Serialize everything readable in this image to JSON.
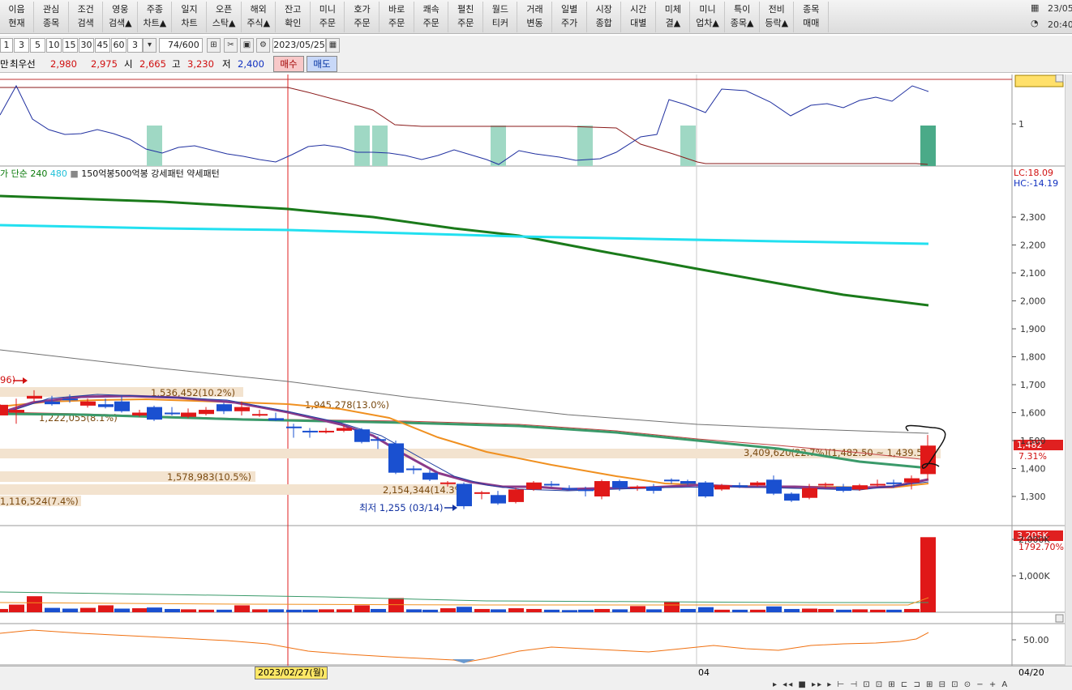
{
  "toolbar": {
    "buttons": [
      {
        "l1": "이음",
        "l2": "현재"
      },
      {
        "l1": "관심",
        "l2": "종목"
      },
      {
        "l1": "조건",
        "l2": "검색"
      },
      {
        "l1": "영웅",
        "l2": "검색▲"
      },
      {
        "l1": "주종",
        "l2": "차트▲"
      },
      {
        "l1": "일지",
        "l2": "차트"
      },
      {
        "l1": "오픈",
        "l2": "스탁▲"
      },
      {
        "l1": "해외",
        "l2": "주식▲"
      },
      {
        "l1": "잔고",
        "l2": "확인"
      },
      {
        "l1": "미니",
        "l2": "주문"
      },
      {
        "l1": "호가",
        "l2": "주문"
      },
      {
        "l1": "바로",
        "l2": "주문"
      },
      {
        "l1": "쾌속",
        "l2": "주문"
      },
      {
        "l1": "펼친",
        "l2": "주문"
      },
      {
        "l1": "월드",
        "l2": "티커"
      },
      {
        "l1": "거래",
        "l2": "변동"
      },
      {
        "l1": "일별",
        "l2": "주가"
      },
      {
        "l1": "시장",
        "l2": "종합"
      },
      {
        "l1": "시간",
        "l2": "대별"
      },
      {
        "l1": "미체",
        "l2": "결▲"
      },
      {
        "l1": "미니",
        "l2": "업차▲"
      },
      {
        "l1": "특이",
        "l2": "종목▲"
      },
      {
        "l1": "전비",
        "l2": "등락▲"
      },
      {
        "l1": "종목",
        "l2": "매매"
      }
    ],
    "date": "23/05",
    "time": "20:40"
  },
  "period": {
    "buttons": [
      "1",
      "3",
      "5",
      "10",
      "15",
      "30",
      "45",
      "60",
      "3"
    ],
    "count": "74",
    "total": "/600",
    "date": "2023/05/25"
  },
  "quote": {
    "prefix": "만",
    "label": "최우선",
    "ask": "2,980",
    "bid": "2,975",
    "open_label": "시",
    "open": "2,665",
    "high_label": "고",
    "high": "3,230",
    "low_label": "저",
    "low": "2,400",
    "buy": "매수",
    "sell": "매도"
  },
  "indicator_top": {
    "tick_label": "1"
  },
  "main_chart": {
    "legend": {
      "prefix": "가 단순",
      "ma240": "240",
      "ma480": "480",
      "rest": "150억봉500억봉 강세패턴  약세패턴"
    },
    "lc": "LC:18.09",
    "hc": "HC:-14.19",
    "y_ticks": [
      "2,300",
      "2,200",
      "2,100",
      "2,000",
      "1,900",
      "1,800",
      "1,700",
      "1,600",
      "1,500",
      "1,400",
      "1,300"
    ],
    "last_price": "1,482",
    "last_change": "7.31%",
    "annotations": {
      "a1": "1,536,452(10.2%)",
      "a2": "1,945,278(13.0%)",
      "a3": "1,222,055(8.1%)",
      "a4": "3,409,620(22.7%)(1,482.50 ~ 1,439.50)",
      "a5": "1,578,983(10.5%)",
      "a6": "2,154,344(14.3%)",
      "a7": "1,116,524(7.4%)",
      "a8": "96)",
      "low": "최저 1,255 (03/14)"
    }
  },
  "volume": {
    "last": "3,205K",
    "pct": "1792.70%",
    "y_ticks": [
      "2,000K",
      "1,000K"
    ]
  },
  "oscillator": {
    "tick": "50.00"
  },
  "x_axis": {
    "cursor_date": "2023/02/27(월)",
    "mid_label": "04",
    "right_label": "04/20"
  }
}
